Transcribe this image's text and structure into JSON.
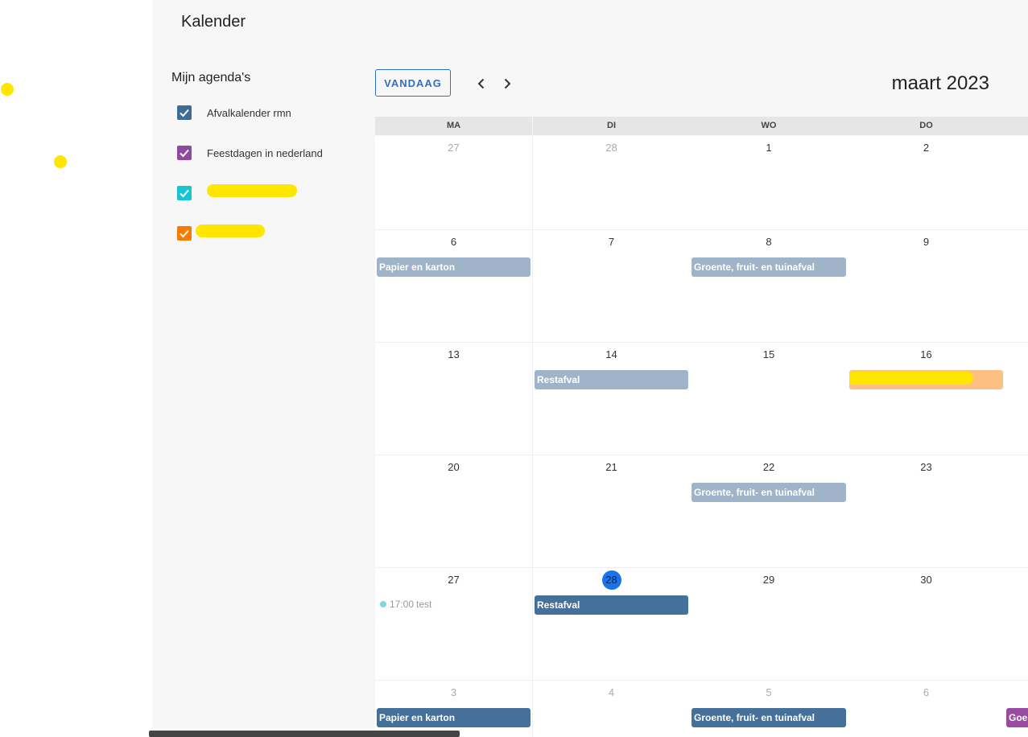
{
  "app": {
    "title": "Kalender"
  },
  "sidebar": {
    "title": "Mijn agenda's",
    "calendars": [
      {
        "label": "Afvalkalender rmn",
        "color": "#3f6b95",
        "checked": true
      },
      {
        "label": "Feestdagen in nederland",
        "color": "#8f4aa0",
        "checked": true
      },
      {
        "label": "",
        "color": "#17c4d1",
        "checked": true,
        "redacted": true
      },
      {
        "label": "",
        "color": "#f57c00",
        "checked": true,
        "redacted": true
      }
    ]
  },
  "toolbar": {
    "today_label": "VANDAAG",
    "prev_icon": "chevron-left-icon",
    "next_icon": "chevron-right-icon",
    "month_label": "maart 2023"
  },
  "weekdays": [
    "MA",
    "DI",
    "WO",
    "DO"
  ],
  "weeks": [
    {
      "days": [
        {
          "num": "27",
          "other": true
        },
        {
          "num": "28",
          "other": true
        },
        {
          "num": "1"
        },
        {
          "num": "2"
        }
      ]
    },
    {
      "days": [
        {
          "num": "6",
          "events": [
            {
              "title": "Papier en karton",
              "style": "pale"
            }
          ]
        },
        {
          "num": "7"
        },
        {
          "num": "8",
          "events": [
            {
              "title": "Groente, fruit- en tuinafval",
              "style": "pale"
            }
          ]
        },
        {
          "num": "9"
        }
      ]
    },
    {
      "days": [
        {
          "num": "13"
        },
        {
          "num": "14",
          "events": [
            {
              "title": "Restafval",
              "style": "pale"
            }
          ]
        },
        {
          "num": "15"
        },
        {
          "num": "16",
          "events": [
            {
              "title": "",
              "style": "orange",
              "redacted": true
            }
          ]
        }
      ]
    },
    {
      "days": [
        {
          "num": "20"
        },
        {
          "num": "21"
        },
        {
          "num": "22",
          "events": [
            {
              "title": "Groente, fruit- en tuinafval",
              "style": "pale"
            }
          ]
        },
        {
          "num": "23"
        }
      ]
    },
    {
      "days": [
        {
          "num": "27",
          "timed": {
            "time": "17:00",
            "title": "test"
          }
        },
        {
          "num": "28",
          "today": true,
          "events": [
            {
              "title": "Restafval",
              "style": "dark"
            }
          ]
        },
        {
          "num": "29"
        },
        {
          "num": "30"
        }
      ]
    },
    {
      "days": [
        {
          "num": "3",
          "other": true,
          "events": [
            {
              "title": "Papier en karton",
              "style": "dark"
            }
          ]
        },
        {
          "num": "4",
          "other": true
        },
        {
          "num": "5",
          "other": true,
          "events": [
            {
              "title": "Groente, fruit- en tuinafval",
              "style": "dark"
            }
          ]
        },
        {
          "num": "6",
          "other": true
        }
      ]
    }
  ],
  "partial_column": {
    "event_title": "Goe",
    "style": "purple"
  }
}
